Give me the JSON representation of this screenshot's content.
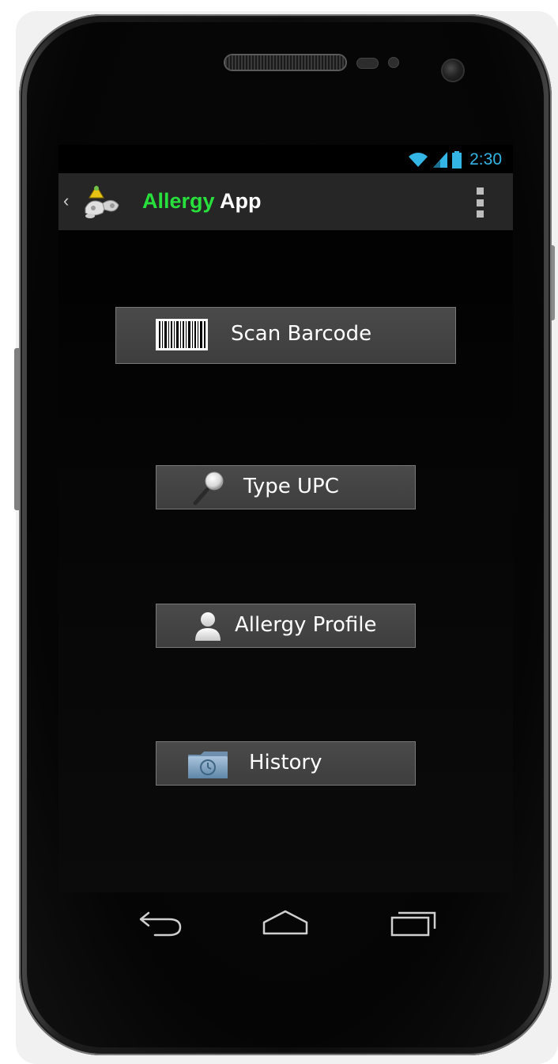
{
  "status_bar": {
    "time": "2:30",
    "accent_color": "#33b5e5",
    "icons": [
      "wifi-icon",
      "signal-icon",
      "battery-icon"
    ]
  },
  "action_bar": {
    "title_part1": "Allergy",
    "title_part2": " App",
    "title_accent_color": "#28e03c",
    "up_icon": "chevron-left-icon",
    "app_icon": "allergy-app-logo-icon",
    "overflow_icon": "overflow-menu-icon"
  },
  "menu": {
    "scan_barcode": {
      "label": "Scan Barcode",
      "icon": "barcode-icon"
    },
    "type_upc": {
      "label": "Type UPC",
      "icon": "magnifier-icon"
    },
    "allergy_profile": {
      "label": "Allergy Profile",
      "icon": "person-icon"
    },
    "history": {
      "label": "History",
      "icon": "history-folder-icon"
    }
  },
  "nav_bar": {
    "buttons": [
      "back-icon",
      "home-icon",
      "recent-apps-icon"
    ]
  }
}
